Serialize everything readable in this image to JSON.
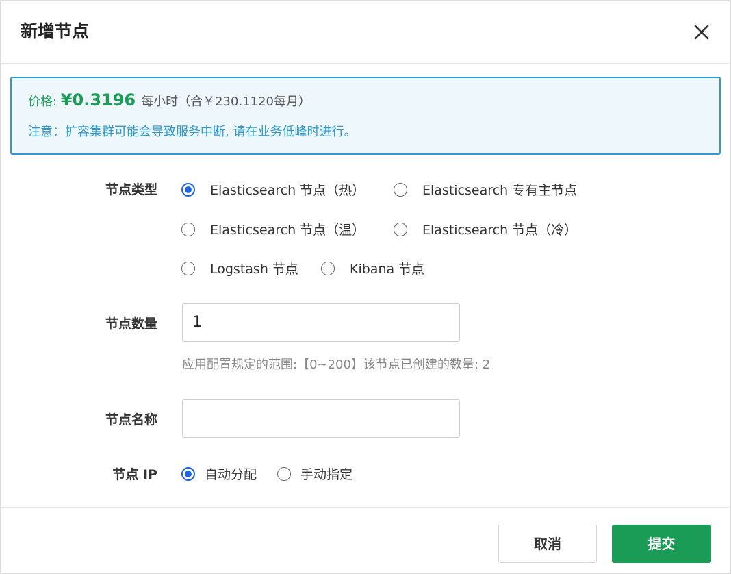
{
  "dialog": {
    "title": "新增节点",
    "close_icon": "close-icon"
  },
  "notice": {
    "price_label": "价格: ",
    "price_value": "¥0.3196",
    "price_note": "每小时（合￥230.1120每月）",
    "warning": "注意：扩容集群可能会导致服务中断, 请在业务低峰时进行。",
    "colors": {
      "price": "#1a9b56",
      "info": "#2c9bd0",
      "background": "#eef7fb"
    }
  },
  "form": {
    "node_type": {
      "label": "节点类型",
      "options": [
        {
          "label": "Elasticsearch 节点（热）",
          "checked": true
        },
        {
          "label": "Elasticsearch 专有主节点",
          "checked": false
        },
        {
          "label": "Elasticsearch 节点（温）",
          "checked": false
        },
        {
          "label": "Elasticsearch 节点（冷）",
          "checked": false
        },
        {
          "label": "Logstash 节点",
          "checked": false
        },
        {
          "label": "Kibana 节点",
          "checked": false
        }
      ]
    },
    "node_count": {
      "label": "节点数量",
      "value": "1",
      "hint": "应用配置规定的范围:【0~200】该节点已创建的数量: 2"
    },
    "node_name": {
      "label": "节点名称",
      "value": "",
      "placeholder": ""
    },
    "node_ip": {
      "label": "节点 IP",
      "options": [
        {
          "label": "自动分配",
          "checked": true
        },
        {
          "label": "手动指定",
          "checked": false
        }
      ]
    }
  },
  "footer": {
    "cancel_label": "取消",
    "submit_label": "提交",
    "colors": {
      "submit": "#1a9b56",
      "radio_checked": "#1e64e6"
    }
  }
}
